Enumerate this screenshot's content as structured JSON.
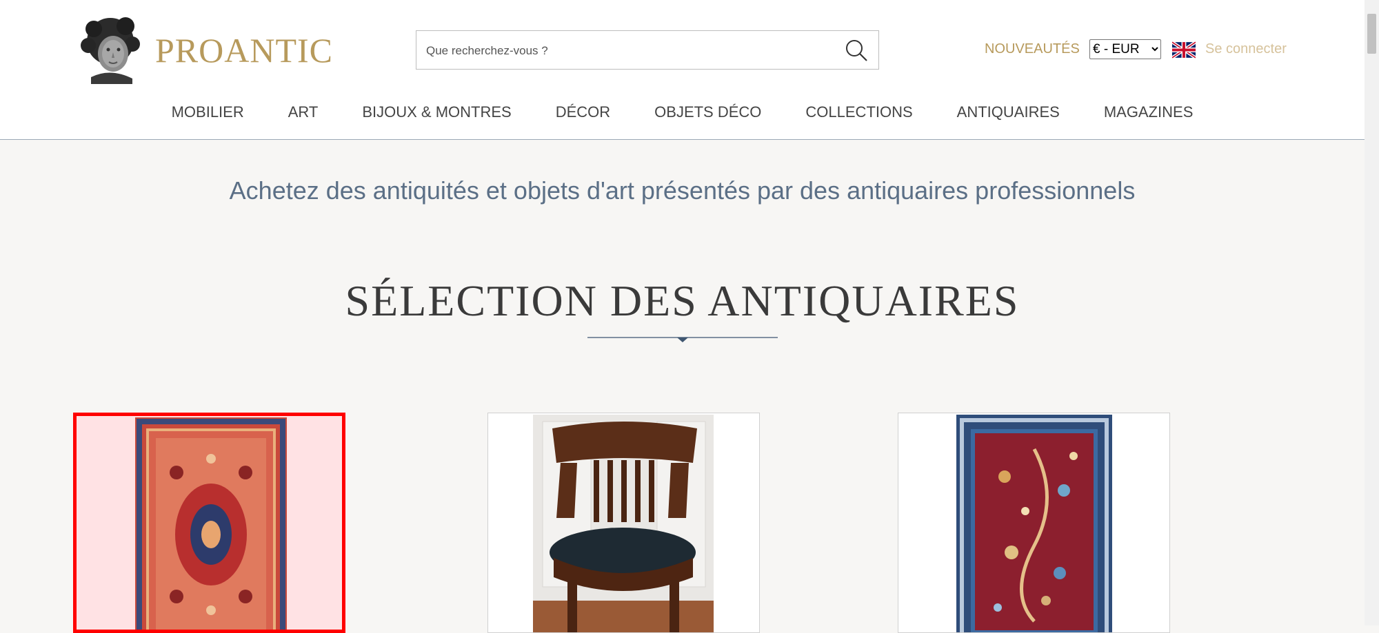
{
  "header": {
    "brand": "PROANTIC",
    "search": {
      "placeholder": "Que recherchez-vous ?"
    },
    "new_items_label": "NOUVEAUTÉS",
    "currency": {
      "selected": "€ - EUR",
      "options": [
        "€ - EUR"
      ]
    },
    "language_flag": "uk-flag-icon",
    "login_label": "Se connecter"
  },
  "nav": {
    "items": [
      {
        "label": "MOBILIER"
      },
      {
        "label": "ART"
      },
      {
        "label": "BIJOUX & MONTRES"
      },
      {
        "label": "DÉCOR"
      },
      {
        "label": "OBJETS DÉCO"
      },
      {
        "label": "COLLECTIONS"
      },
      {
        "label": "ANTIQUAIRES"
      },
      {
        "label": "MAGAZINES"
      }
    ]
  },
  "main": {
    "tagline": "Achetez des antiquités et objets d'art présentés par des antiquaires professionnels",
    "section_title": "SÉLECTION DES ANTIQUAIRES",
    "products": [
      {
        "image": "persian-rug-red-image",
        "selected": true
      },
      {
        "image": "mahogany-armchair-image",
        "selected": false
      },
      {
        "image": "pictorial-rug-blue-image",
        "selected": false
      }
    ]
  },
  "colors": {
    "brand_gold": "#b79a5c",
    "text_blue": "#5b6f86",
    "selection_red": "#ff0000"
  }
}
